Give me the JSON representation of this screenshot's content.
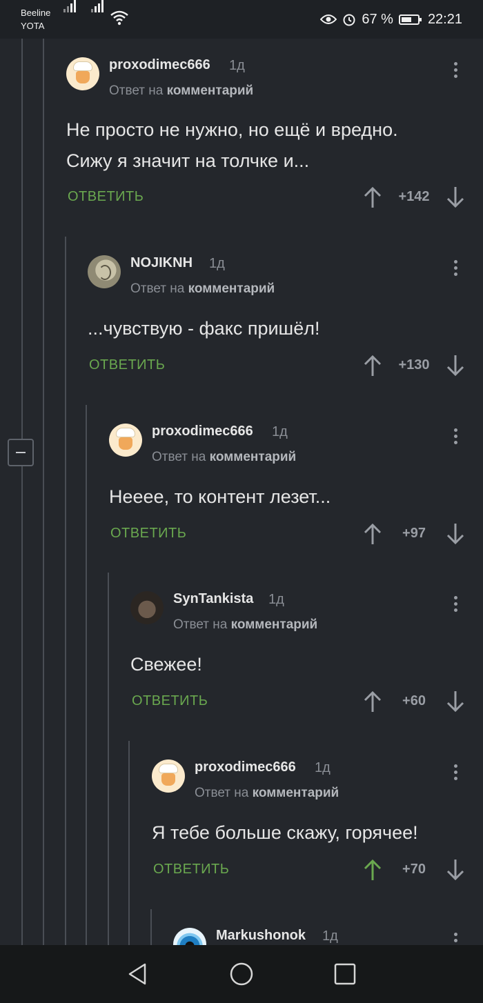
{
  "status_bar": {
    "carrier_1": "Beeline",
    "carrier_2": "YOTA",
    "battery": "67 %",
    "time": "22:21"
  },
  "reply_label": "ОТВЕТИТЬ",
  "colors": {
    "background": "#24272c",
    "accent": "#6aa84f",
    "upvoted": "#6aa84f"
  },
  "comments": [
    {
      "author": "proxodimec666",
      "time": "1д",
      "reply_prefix": "Ответ на",
      "reply_target": "комментарий",
      "text_lines": [
        "Не просто не нужно, но ещё и вредно.",
        "Сижу я значит на толчке и..."
      ],
      "score": "+142",
      "avatar": "chef-avatar",
      "upvoted": false
    },
    {
      "author": "NOJIKNH",
      "time": "1д",
      "reply_prefix": "Ответ на",
      "reply_target": "комментарий",
      "text_lines": [
        "...чувствую - факс пришёл!"
      ],
      "score": "+130",
      "avatar": "egg-avatar",
      "upvoted": false
    },
    {
      "author": "proxodimec666",
      "time": "1д",
      "reply_prefix": "Ответ на",
      "reply_target": "комментарий",
      "text_lines": [
        "Нееее, то контент лезет..."
      ],
      "score": "+97",
      "avatar": "chef-avatar",
      "upvoted": false
    },
    {
      "author": "SynTankista",
      "time": "1д",
      "reply_prefix": "Ответ на",
      "reply_target": "комментарий",
      "text_lines": [
        "Свежее!"
      ],
      "score": "+60",
      "avatar": "tankist-avatar",
      "upvoted": false
    },
    {
      "author": "proxodimec666",
      "time": "1д",
      "reply_prefix": "Ответ на",
      "reply_target": "комментарий",
      "text_lines": [
        "Я тебе больше скажу, горячее!"
      ],
      "score": "+70",
      "avatar": "chef-avatar",
      "upvoted": true
    },
    {
      "author": "Markushonok",
      "time": "1д",
      "avatar": "eye-avatar"
    }
  ],
  "nav_bar": {
    "buttons": [
      "back-icon",
      "home-icon",
      "recents-icon"
    ]
  }
}
